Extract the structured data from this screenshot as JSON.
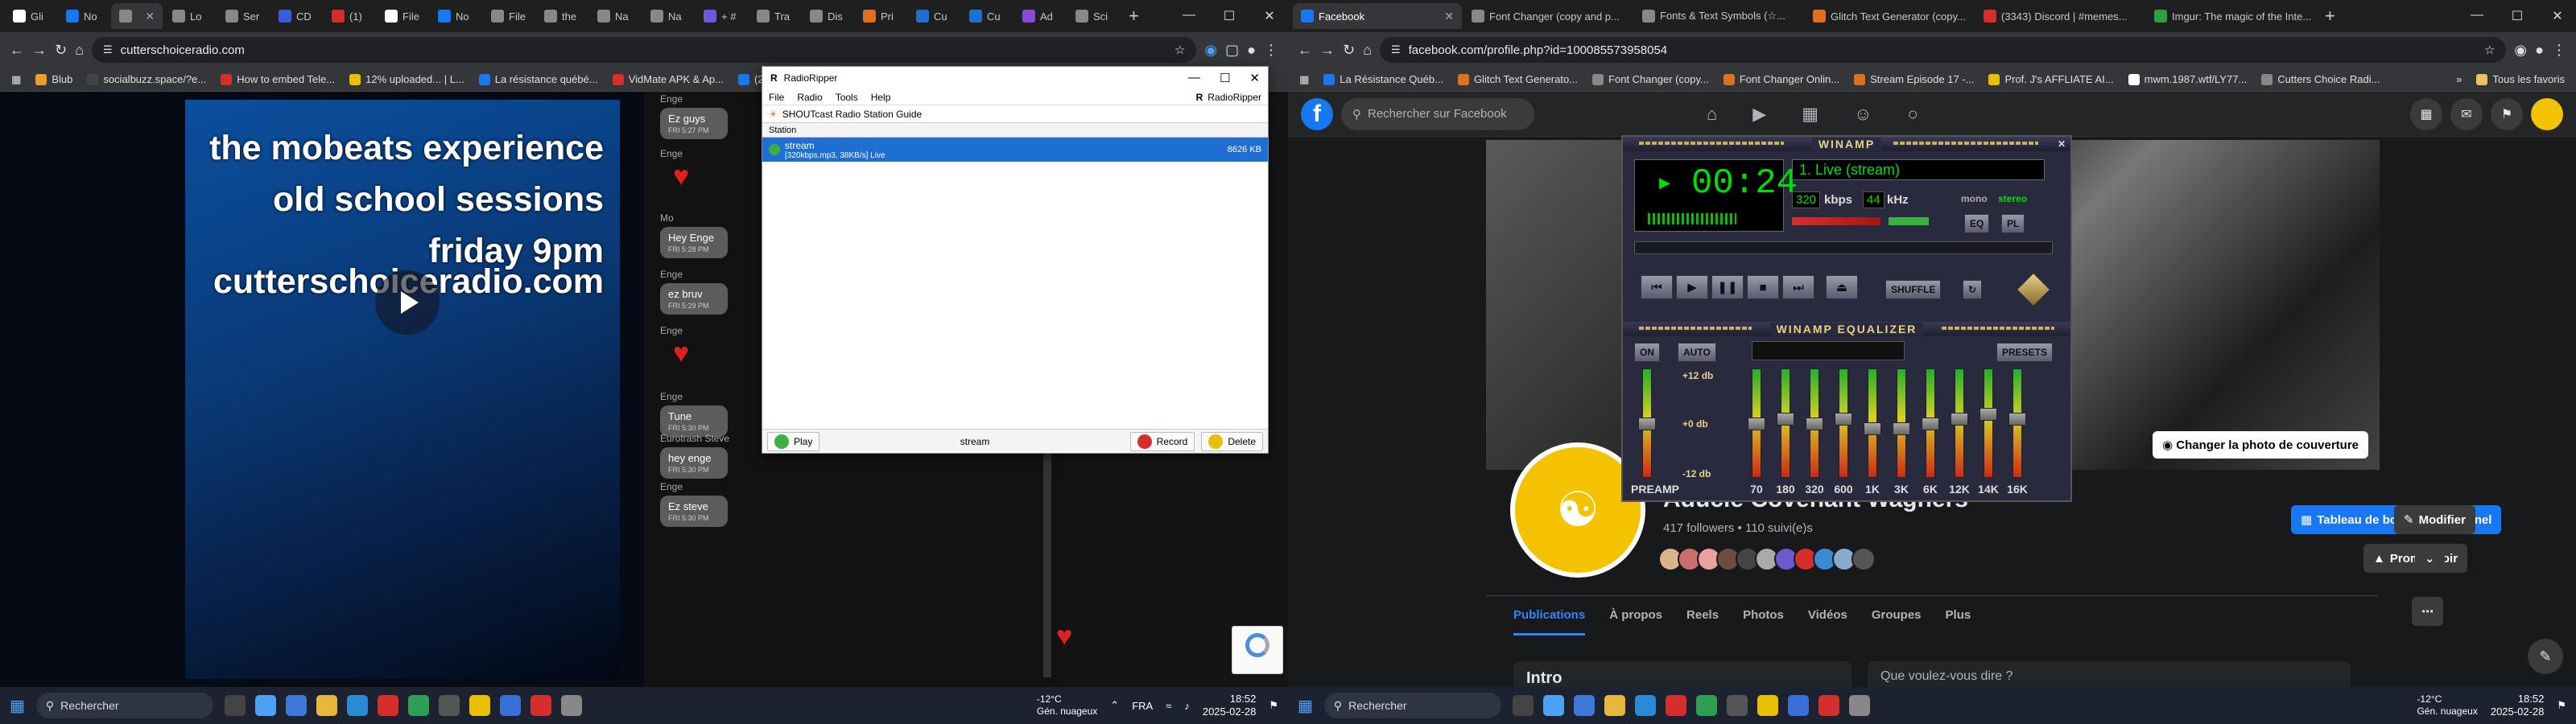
{
  "left": {
    "tabs": [
      {
        "label": "Gli",
        "color": "#ffffff",
        "active": false
      },
      {
        "label": "No",
        "color": "#1877f2",
        "active": false
      },
      {
        "label": "",
        "color": "#888888",
        "active": true
      },
      {
        "label": "Lo",
        "color": "#888888",
        "active": false
      },
      {
        "label": "Ser",
        "color": "#888888",
        "active": false
      },
      {
        "label": "CD",
        "color": "#3b5bd9",
        "active": false
      },
      {
        "label": "(1)",
        "color": "#d62d2d",
        "active": false
      },
      {
        "label": "File",
        "color": "#ffffff",
        "active": false
      },
      {
        "label": "No",
        "color": "#1877f2",
        "active": false
      },
      {
        "label": "File",
        "color": "#888888",
        "active": false
      },
      {
        "label": "the",
        "color": "#888888",
        "active": false
      },
      {
        "label": "Na",
        "color": "#888888",
        "active": false
      },
      {
        "label": "Na",
        "color": "#888888",
        "active": false
      },
      {
        "label": "+ #",
        "color": "#6b5bd9",
        "active": false
      },
      {
        "label": "Tra",
        "color": "#888888",
        "active": false
      },
      {
        "label": "Dis",
        "color": "#888888",
        "active": false
      },
      {
        "label": "Pri",
        "color": "#e07020",
        "active": false
      },
      {
        "label": "Cu",
        "color": "#1f6fd2",
        "active": false
      },
      {
        "label": "Cu",
        "color": "#1f6fd2",
        "active": false
      },
      {
        "label": "Ad",
        "color": "#8a4bd9",
        "active": false
      },
      {
        "label": "Sci",
        "color": "#888888",
        "active": false
      }
    ],
    "new_tab": "+",
    "url": "cutterschoiceradio.com",
    "bookmarks": [
      {
        "label": "Blub",
        "color": "#e8a02a"
      },
      {
        "label": "socialbuzz.space/?e...",
        "color": "#444444"
      },
      {
        "label": "How to embed Tele...",
        "color": "#d62d2d"
      },
      {
        "label": "12% uploaded... | L...",
        "color": "#e8c000"
      },
      {
        "label": "La résistance québé...",
        "color": "#1877f2"
      },
      {
        "label": "VidMate APK & Ap...",
        "color": "#d62d2d"
      },
      {
        "label": "(20)",
        "color": "#1877f2"
      }
    ],
    "video_lines": [
      "the mobeats experience",
      "old school sessions",
      "friday 9pm",
      "cutterschoiceradio.com"
    ],
    "chat": [
      {
        "who": "Enge",
        "text": "Ez guys",
        "time": "FRI 5:27 PM",
        "type": "bubble"
      },
      {
        "who": "Enge",
        "text": "",
        "time": "",
        "type": "heart"
      },
      {
        "who": "Mo",
        "text": "Hey Enge",
        "time": "FRI 5:28 PM",
        "type": "bubble"
      },
      {
        "who": "Enge",
        "text": "ez bruv",
        "time": "FRI 5:29 PM",
        "type": "bubble"
      },
      {
        "who": "Enge",
        "text": "",
        "time": "",
        "type": "heart"
      },
      {
        "who": "Enge",
        "text": "Tune",
        "time": "FRI 5:30 PM",
        "type": "bubble"
      },
      {
        "who": "Eurotrash Steve",
        "text": "hey enge",
        "time": "FRI 5:30 PM",
        "type": "bubble"
      },
      {
        "who": "Enge",
        "text": "Ez steve",
        "time": "FRI 5:30 PM",
        "type": "bubble"
      }
    ]
  },
  "radioripper": {
    "title": "RadioRipper",
    "menu": [
      "File",
      "Radio",
      "Tools",
      "Help"
    ],
    "brand": "RadioRipper",
    "toolbar": "SHOUTcast Radio Station Guide",
    "column": "Station",
    "row_line1": "stream",
    "row_line2": "[320kbps,mp3, 38KB/s] Live",
    "row_size": "8626 KB",
    "play": "Play",
    "status_center": "stream",
    "record": "Record",
    "delete": "Delete"
  },
  "right": {
    "tabs": [
      {
        "label": "Facebook",
        "color": "#1877f2",
        "active": true
      },
      {
        "label": "Font Changer (copy and p...",
        "color": "#888888",
        "active": false
      },
      {
        "label": "Fonts & Text Symbols (☆...",
        "color": "#888888",
        "active": false
      },
      {
        "label": "Glitch Text Generator (copy...",
        "color": "#e07020",
        "active": false
      },
      {
        "label": "(3343) Discord | #memes...",
        "color": "#d62d2d",
        "active": false
      },
      {
        "label": "Imgur: The magic of the Inte...",
        "color": "#2ea043",
        "active": false
      }
    ],
    "url": "facebook.com/profile.php?id=100085573958054",
    "bookmarks": [
      {
        "label": "La Résistance Québ...",
        "color": "#1877f2"
      },
      {
        "label": "Glitch Text Generato...",
        "color": "#e07020"
      },
      {
        "label": "Font Changer (copy...",
        "color": "#888888"
      },
      {
        "label": "Font Changer Onlin...",
        "color": "#e07020"
      },
      {
        "label": "Stream Episode 17 -...",
        "color": "#e07020"
      },
      {
        "label": "Prof. J's AFFLIATE AI...",
        "color": "#e8c000"
      },
      {
        "label": "mwm.1987.wtf/LY77...",
        "color": "#ffffff"
      },
      {
        "label": "Cutters Choice Radi...",
        "color": "#888888"
      }
    ],
    "all_bookmarks": "Tous les favoris",
    "fb": {
      "search_placeholder": "Rechercher sur Facebook",
      "cover_button": "Changer la photo de couverture",
      "name": "Aducle Covenant Wagners",
      "followers": "417 followers • 110 suivi(e)s",
      "pro_button": "Tableau de bord professionnel",
      "edit_button": "Modifier",
      "promo_button": "Promouvoir",
      "tabs": [
        "Publications",
        "À propos",
        "Reels",
        "Photos",
        "Vidéos",
        "Groupes",
        "Plus"
      ],
      "intro": "Intro",
      "post_prompt": "Que voulez-vous dire ?",
      "friend_colors": [
        "#d9b38c",
        "#c96d6d",
        "#e8a0a0",
        "#6d4c41",
        "#444",
        "#aaa",
        "#6a5acd",
        "#d62d2d",
        "#3a8ad6",
        "#88aacc",
        "#555"
      ]
    }
  },
  "winamp": {
    "title": "WINAMP",
    "time": "00:24",
    "song": "1. Live (stream)",
    "kbps": "320",
    "kbps_label": "kbps",
    "khz": "44",
    "khz_label": "kHz",
    "mono": "mono",
    "stereo": "stereo",
    "eq_btn": "EQ",
    "pl_btn": "PL",
    "shuffle": "SHUFFLE",
    "eq_title": "WINAMP EQUALIZER",
    "on": "ON",
    "auto": "AUTO",
    "presets": "PRESETS",
    "db_top": "+12 db",
    "db_mid": "+0 db",
    "db_bot": "-12 db",
    "preamp": "PREAMP",
    "bands": [
      "70",
      "180",
      "320",
      "600",
      "1K",
      "3K",
      "6K",
      "12K",
      "14K",
      "16K"
    ],
    "band_levels": [
      0.5,
      0.55,
      0.5,
      0.55,
      0.45,
      0.45,
      0.5,
      0.55,
      0.6,
      0.55
    ],
    "preamp_level": 0.5
  },
  "taskbar": {
    "search": "Rechercher",
    "temp": "-12°C",
    "weather": "Gén. nuageux",
    "lang": "FRA",
    "time": "18:52",
    "date": "2025-02-28",
    "icon_colors": [
      "#444",
      "#4ea0f5",
      "#3b78d8",
      "#e8b73a",
      "#2a8ad6",
      "#d62d2d",
      "#2e9e54",
      "#555",
      "#e8c000",
      "#3a6ed8",
      "#d62d2d",
      "#888"
    ]
  }
}
